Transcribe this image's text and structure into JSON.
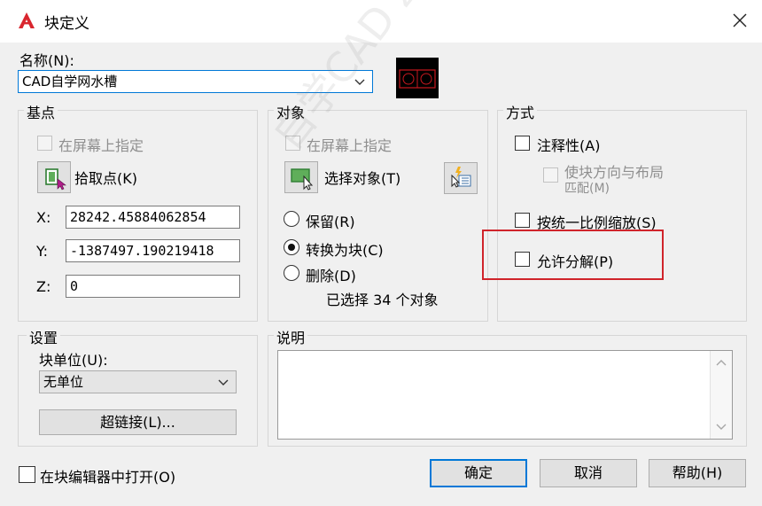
{
  "title": "块定义",
  "name": {
    "label": "名称(N):",
    "value": "CAD自学网水槽"
  },
  "base_point": {
    "group_label": "基点",
    "specify_onscreen": "在屏幕上指定",
    "pick_point": "拾取点(K)",
    "x_label": "X:",
    "x_value": "28242.45884062854",
    "y_label": "Y:",
    "y_value": "-1387497.190219418",
    "z_label": "Z:",
    "z_value": "0"
  },
  "objects": {
    "group_label": "对象",
    "specify_onscreen": "在屏幕上指定",
    "select_objects": "选择对象(T)",
    "retain": "保留(R)",
    "convert": "转换为块(C)",
    "delete": "删除(D)",
    "selected_count_text": "已选择 34 个对象",
    "selected_radio": "convert"
  },
  "behavior": {
    "group_label": "方式",
    "annotative": "注释性(A)",
    "match_orientation_line1": "使块方向与布局",
    "match_orientation_line2": "匹配(M)",
    "scale_uniformly": "按统一比例缩放(S)",
    "allow_explode": "允许分解(P)",
    "highlight_color": "#d0242b"
  },
  "settings": {
    "group_label": "设置",
    "block_unit_label": "块单位(U):",
    "block_unit_value": "无单位",
    "hyperlink": "超链接(L)..."
  },
  "description": {
    "group_label": "说明",
    "text": ""
  },
  "open_in_editor": "在块编辑器中打开(O)",
  "buttons": {
    "ok": "确定",
    "cancel": "取消",
    "help": "帮助(H)"
  },
  "watermark": "自学CAD zxcad.com",
  "colors": {
    "accent": "#0078d7",
    "app_icon": "#d9262e",
    "preview_bg": "#000000",
    "preview_lines": "#c8181f"
  }
}
